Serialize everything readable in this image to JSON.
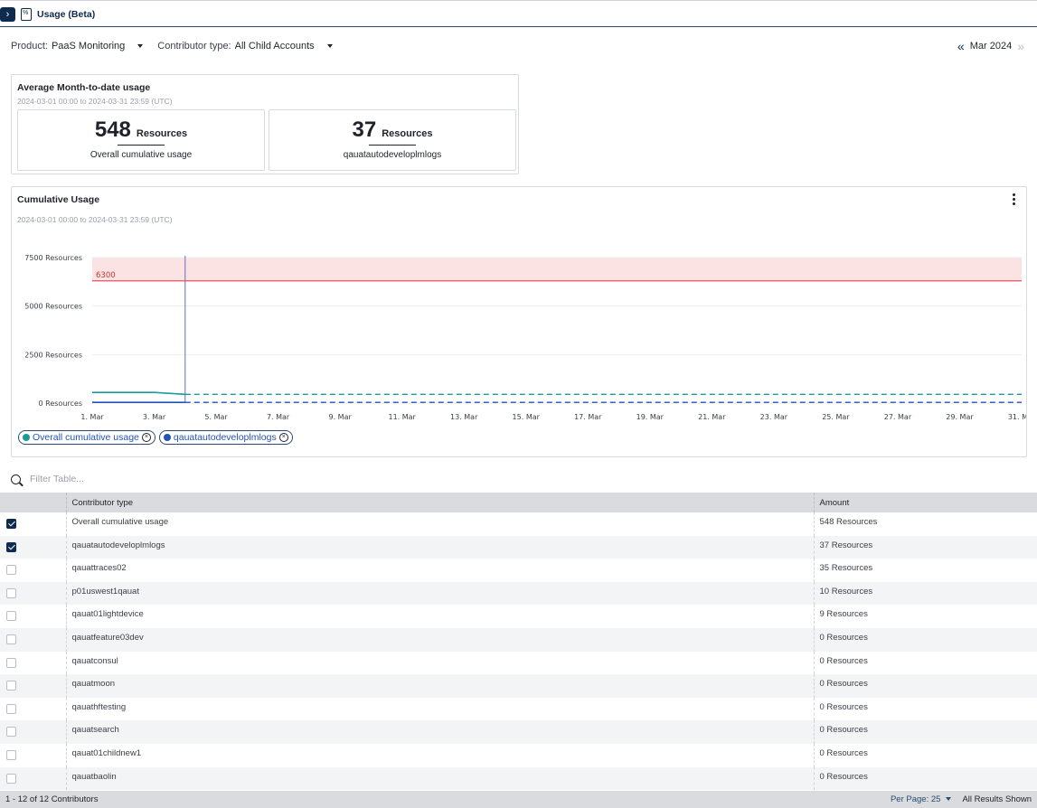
{
  "header": {
    "title": "Usage (Beta)"
  },
  "filters": {
    "product_label": "Product:",
    "product_value": "PaaS Monitoring",
    "contributor_label": "Contributor type:",
    "contributor_value": "All Child Accounts",
    "month": "Mar 2024"
  },
  "summary": {
    "title": "Average Month-to-date usage",
    "range": "2024-03-01 00:00 to 2024-03-31 23:59 (UTC)",
    "kpis": [
      {
        "value": "548",
        "unit": "Resources",
        "label": "Overall cumulative usage"
      },
      {
        "value": "37",
        "unit": "Resources",
        "label": "qauatautodeveloplmlogs"
      }
    ]
  },
  "cumulative": {
    "title": "Cumulative Usage",
    "range": "2024-03-01 00:00 to 2024-03-31 23:59 (UTC)"
  },
  "chart_data": {
    "type": "line",
    "x": [
      "1. Mar",
      "3. Mar",
      "5. Mar",
      "7. Mar",
      "9. Mar",
      "11. Mar",
      "13. Mar",
      "15. Mar",
      "17. Mar",
      "19. Mar",
      "21. Mar",
      "23. Mar",
      "25. Mar",
      "27. Mar",
      "29. Mar",
      "31. Mar"
    ],
    "x_days": [
      1,
      31
    ],
    "ylim": [
      0,
      7500
    ],
    "yticks": [
      0,
      2500,
      5000,
      7500
    ],
    "ytick_labels": [
      "0 Resources",
      "2500 Resources",
      "5000 Resources",
      "7500 Resources"
    ],
    "threshold": {
      "value": 6300,
      "label": "6300",
      "band": [
        6300,
        7500
      ],
      "color": "#e8525a"
    },
    "cursor_day": 4,
    "series": [
      {
        "name": "Overall cumulative usage",
        "color": "#1a9a9a",
        "solid": [
          [
            1,
            548
          ],
          [
            3,
            548
          ],
          [
            4,
            450
          ]
        ],
        "dashed": [
          [
            4,
            450
          ],
          [
            31,
            450
          ]
        ]
      },
      {
        "name": "qauatautodeveloplmlogs",
        "color": "#2453b8",
        "solid": [
          [
            1,
            37
          ],
          [
            4,
            37
          ]
        ],
        "dashed": [
          [
            4,
            37
          ],
          [
            31,
            37
          ]
        ]
      }
    ]
  },
  "legend": [
    {
      "label": "Overall cumulative usage",
      "color": "#1a9a9a"
    },
    {
      "label": "qauatautodeveloplmlogs",
      "color": "#2453b8"
    }
  ],
  "table": {
    "filter_placeholder": "Filter Table...",
    "headers": [
      "Contributor type",
      "Amount"
    ],
    "rows": [
      {
        "checked": true,
        "type": "Overall cumulative usage",
        "amount": "548 Resources"
      },
      {
        "checked": true,
        "type": "qauatautodeveloplmlogs",
        "amount": "37 Resources"
      },
      {
        "checked": false,
        "type": "qauattraces02",
        "amount": "35 Resources"
      },
      {
        "checked": false,
        "type": "p01uswest1qauat",
        "amount": "10 Resources"
      },
      {
        "checked": false,
        "type": "qauat01lightdevice",
        "amount": "9 Resources"
      },
      {
        "checked": false,
        "type": "qauatfeature03dev",
        "amount": "0 Resources"
      },
      {
        "checked": false,
        "type": "qauatconsul",
        "amount": "0 Resources"
      },
      {
        "checked": false,
        "type": "qauatmoon",
        "amount": "0 Resources"
      },
      {
        "checked": false,
        "type": "qauathftesting",
        "amount": "0 Resources"
      },
      {
        "checked": false,
        "type": "qauatsearch",
        "amount": "0 Resources"
      },
      {
        "checked": false,
        "type": "qauat01childnew1",
        "amount": "0 Resources"
      },
      {
        "checked": false,
        "type": "qauatbaolin",
        "amount": "0 Resources"
      }
    ],
    "footer_count": "1 - 12 of 12 Contributors",
    "per_page": "Per Page: 25",
    "results": "All Results Shown"
  }
}
